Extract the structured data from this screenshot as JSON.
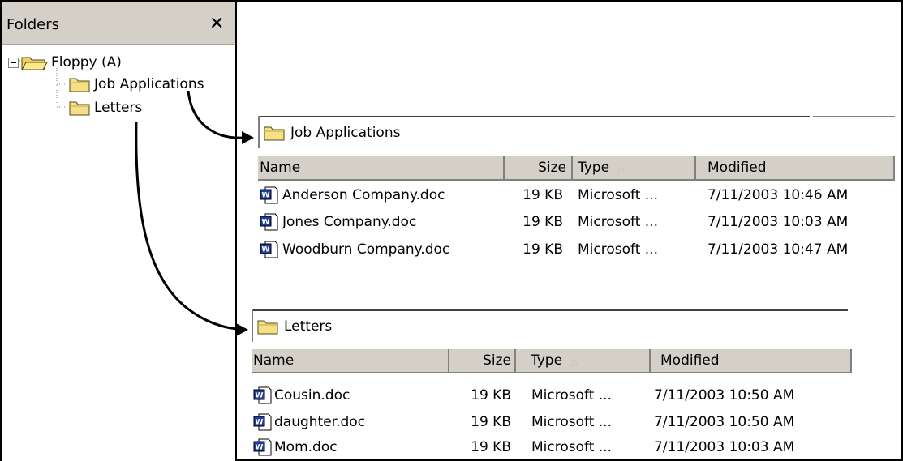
{
  "folders": {
    "title": "Folders",
    "close_glyph": "✕",
    "tree": {
      "root": "Floppy (A)",
      "children": [
        "Job Applications",
        "Letters"
      ]
    }
  },
  "panels": [
    {
      "address": "Job Applications",
      "columns": {
        "name": "Name",
        "size": "Size",
        "type": "Type",
        "modified": "Modified"
      },
      "rows": [
        {
          "name": "Anderson Company.doc",
          "size": "19 KB",
          "type": "Microsoft ...",
          "modified": "7/11/2003 10:46 AM"
        },
        {
          "name": "Jones Company.doc",
          "size": "19 KB",
          "type": "Microsoft ...",
          "modified": "7/11/2003 10:03 AM"
        },
        {
          "name": "Woodburn Company.doc",
          "size": "19 KB",
          "type": "Microsoft ...",
          "modified": "7/11/2003 10:47 AM"
        }
      ]
    },
    {
      "address": "Letters",
      "columns": {
        "name": "Name",
        "size": "Size",
        "type": "Type",
        "modified": "Modified"
      },
      "rows": [
        {
          "name": "Cousin.doc",
          "size": "19 KB",
          "type": "Microsoft ...",
          "modified": "7/11/2003 10:50 AM"
        },
        {
          "name": "daughter.doc",
          "size": "19 KB",
          "type": "Microsoft ...",
          "modified": "7/11/2003 10:50 AM"
        },
        {
          "name": "Mom.doc",
          "size": "19 KB",
          "type": "Microsoft ...",
          "modified": "7/11/2003 10:03 AM"
        }
      ]
    }
  ],
  "colors": {
    "folder_fill": "#f5e08a",
    "header_bg": "#d4d0c8",
    "word_blue": "#1f3d9c"
  }
}
